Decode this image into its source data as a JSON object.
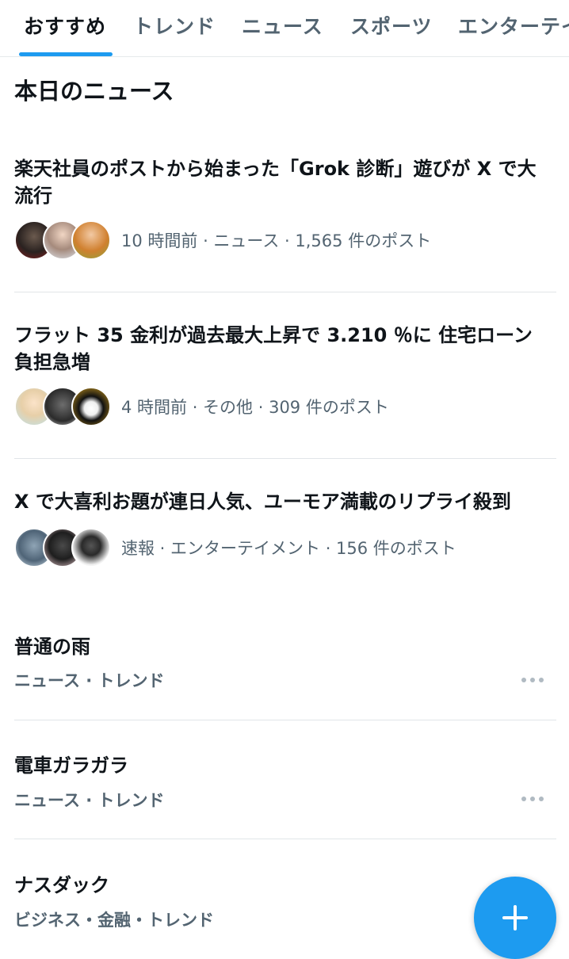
{
  "tabs": [
    {
      "label": "おすすめ"
    },
    {
      "label": "トレンド"
    },
    {
      "label": "ニュース"
    },
    {
      "label": "スポーツ"
    },
    {
      "label": "エンターテイ"
    }
  ],
  "section_title": "本日のニュース",
  "news": [
    {
      "title_line1": "楽天社員のポストから始まった「Grok 診断」遊びが X で大",
      "title_line2": "流行",
      "meta": "10 時間前 · ニュース · 1,565 件のポスト"
    },
    {
      "title_line1": "フラット 35 金利が過去最大上昇で 3.210 ％に 住宅ローン",
      "title_line2": "負担急増",
      "meta": "4 時間前 · その他 · 309 件のポスト"
    },
    {
      "title_line1": "X で大喜利お題が連日人気、ユーモア満載のリプライ殺到",
      "meta": "速報 · エンターテイメント · 156 件のポスト"
    }
  ],
  "trends": [
    {
      "title": "普通の雨",
      "subtitle": "ニュース · トレンド"
    },
    {
      "title": "電車ガラガラ",
      "subtitle": "ニュース · トレンド"
    },
    {
      "title": "ナスダック",
      "subtitle": "ビジネス・金融・トレンド"
    }
  ],
  "icons": {
    "more": "more-horizontal-icon",
    "compose": "plus-icon"
  },
  "colors": {
    "accent": "#1d9bf0",
    "text_primary": "#0f1419",
    "text_secondary": "#536471"
  }
}
